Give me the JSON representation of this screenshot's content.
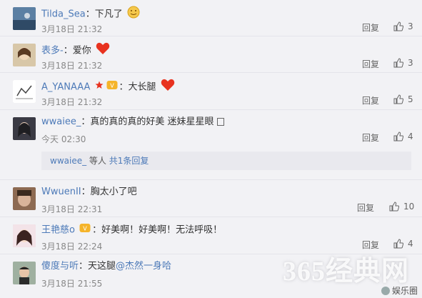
{
  "reply_label": "回复",
  "comments": [
    {
      "user": "Tilda_Sea",
      "text": "下凡了",
      "time": "3月18日 21:32",
      "likes": "3",
      "emoji": "face"
    },
    {
      "user": "表多-",
      "text": "爱你",
      "time": "3月18日 21:32",
      "likes": "3",
      "emoji": "heart"
    },
    {
      "user": "A_YANAAA",
      "text": "大长腿",
      "time": "3月18日 21:32",
      "likes": "5",
      "emoji": "heart"
    },
    {
      "user": "wwaiee_",
      "text": "真的真的真的好美 迷妹星星眼",
      "time": "今天 02:30",
      "likes": "4"
    },
    {
      "user": "WwuenII",
      "text": "胸太小了吧",
      "time": "3月18日 22:31",
      "likes": "10"
    },
    {
      "user": "王艳慈o",
      "text": "好美啊！好美啊！无法呼吸！",
      "time": "3月18日 22:24",
      "likes": "4"
    },
    {
      "user": "傻度与听",
      "text": "天这腿",
      "mention": "@杰然一身哈",
      "time": "3月18日 21:55"
    }
  ],
  "subreply": {
    "user": "wwaiee_",
    "middle": "等人",
    "link": "共1条回复"
  },
  "colors": {
    "username": "#4d7ab8",
    "background": "#f2f2f5",
    "heart": "#e8321f"
  }
}
